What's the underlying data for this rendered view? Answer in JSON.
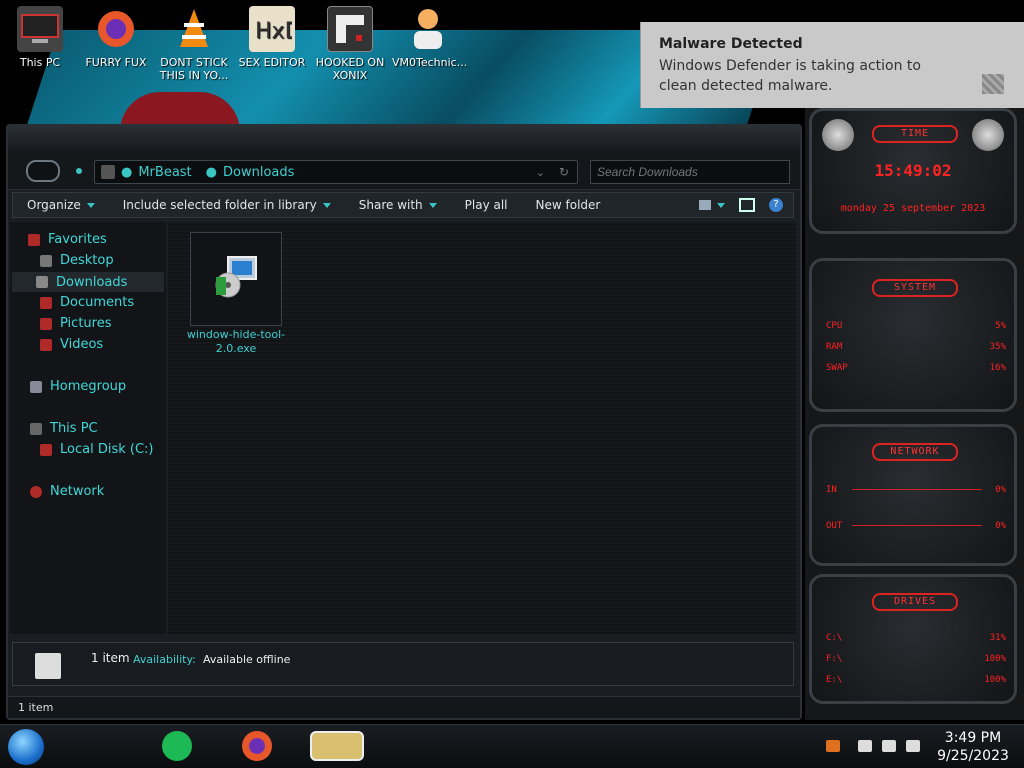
{
  "desktop": {
    "icons": [
      {
        "label": "This PC"
      },
      {
        "label": "FURRY FUX"
      },
      {
        "label": "DONT STICK THIS IN YO..."
      },
      {
        "label": "SEX EDITOR"
      },
      {
        "label": "HOOKED ON XONIX"
      },
      {
        "label": "VM0Technic..."
      }
    ]
  },
  "toast": {
    "title": "Malware Detected",
    "message": "Windows Defender is taking action to clean detected malware."
  },
  "explorer": {
    "address": {
      "segments": [
        "MrBeast",
        "Downloads"
      ]
    },
    "search_placeholder": "Search Downloads",
    "commands": {
      "organize": "Organize",
      "include": "Include selected folder in library",
      "share": "Share with",
      "play": "Play all",
      "new_folder": "New folder"
    },
    "nav": {
      "favorites": "Favorites",
      "desktop": "Desktop",
      "downloads": "Downloads",
      "documents": "Documents",
      "pictures": "Pictures",
      "videos": "Videos",
      "homegroup": "Homegroup",
      "this_pc": "This PC",
      "local_disk": "Local Disk (C:)",
      "network": "Network"
    },
    "file": {
      "name": "window-hide-tool-2.0.exe"
    },
    "details": {
      "count": "1 item",
      "availability_label": "Availability:",
      "availability_value": "Available offline"
    },
    "status": "1 item"
  },
  "gadgets": {
    "time": {
      "title": "TIME",
      "clock": "15:49:02",
      "date": "monday 25 september 2023"
    },
    "system": {
      "title": "SYSTEM",
      "cpu_label": "CPU",
      "cpu_value": "5%",
      "ram_label": "RAM",
      "ram_value": "35%",
      "swap_label": "SWAP",
      "swap_value": "16%"
    },
    "network": {
      "title": "NETWORK",
      "in_label": "IN",
      "in_value": "0%",
      "out_label": "OUT",
      "out_value": "0%"
    },
    "drives": {
      "title": "DRIVES",
      "d1_label": "C:\\",
      "d1_value": "31%",
      "d2_label": "F:\\",
      "d2_value": "100%",
      "d3_label": "E:\\",
      "d3_value": "100%"
    }
  },
  "taskbar": {
    "time": "3:49 PM",
    "date": "9/25/2023"
  }
}
